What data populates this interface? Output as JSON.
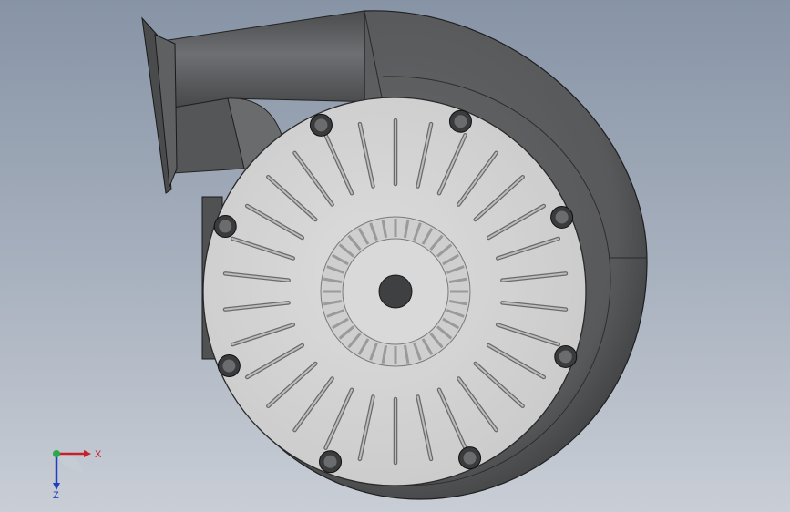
{
  "viewport": {
    "background_top": "#8794a6",
    "background_bottom": "#c9ced6"
  },
  "model": {
    "housing_color": "#58595b",
    "plate_color": "#d4d4d4",
    "bolt_count": 8,
    "slot_count": 30
  },
  "triad": {
    "x_label": "X",
    "z_label": "Z",
    "x_color": "#c8202a",
    "y_color": "#2aa84a",
    "z_color": "#2040c0"
  }
}
